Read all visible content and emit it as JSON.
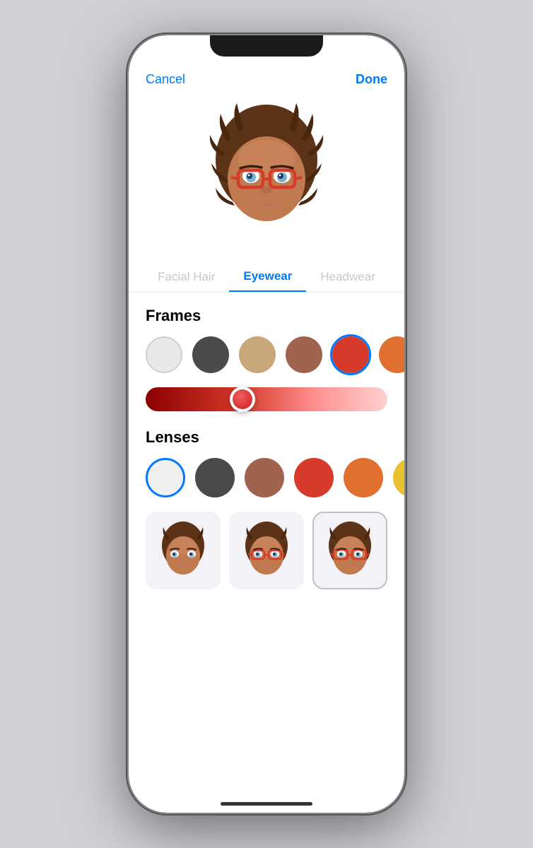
{
  "phone": {
    "nav": {
      "cancel_label": "Cancel",
      "done_label": "Done"
    },
    "tabs": [
      {
        "id": "facial-hair",
        "label": "Facial Hair",
        "state": "inactive"
      },
      {
        "id": "eyewear",
        "label": "Eyewear",
        "state": "active"
      },
      {
        "id": "headwear",
        "label": "Headwear",
        "state": "inactive"
      }
    ],
    "sections": {
      "frames": {
        "label": "Frames",
        "colors": [
          {
            "id": "white",
            "hex": "#e8e8e8",
            "selected": false
          },
          {
            "id": "dark-gray",
            "hex": "#4a4a4a",
            "selected": false
          },
          {
            "id": "tan",
            "hex": "#c8a87a",
            "selected": false
          },
          {
            "id": "brown",
            "hex": "#a0634e",
            "selected": false
          },
          {
            "id": "red",
            "hex": "#d63a2b",
            "selected": true
          },
          {
            "id": "orange",
            "hex": "#e07030",
            "selected": false
          },
          {
            "id": "yellow",
            "hex": "#e8c030",
            "selected": false
          }
        ],
        "slider": {
          "value": 40,
          "track_start": "#8B0000",
          "track_end": "#FFB3B3"
        }
      },
      "lenses": {
        "label": "Lenses",
        "colors": [
          {
            "id": "clear",
            "hex": "#f0f0f0",
            "border": "#c7c7cc",
            "selected": true
          },
          {
            "id": "dark-gray",
            "hex": "#4a4a4a",
            "selected": false
          },
          {
            "id": "brown",
            "hex": "#a0634e",
            "selected": false
          },
          {
            "id": "red",
            "hex": "#d63a2b",
            "selected": false
          },
          {
            "id": "orange",
            "hex": "#e07030",
            "selected": false
          },
          {
            "id": "yellow",
            "hex": "#e8c030",
            "selected": false
          },
          {
            "id": "green",
            "hex": "#4caf50",
            "selected": false
          }
        ]
      }
    },
    "style_thumbnails": [
      {
        "id": "no-glasses",
        "label": "No glasses",
        "selected": false
      },
      {
        "id": "red-glasses-1",
        "label": "Red glasses style 1",
        "selected": false
      },
      {
        "id": "red-glasses-2",
        "label": "Red glasses style 2",
        "selected": true
      }
    ]
  }
}
